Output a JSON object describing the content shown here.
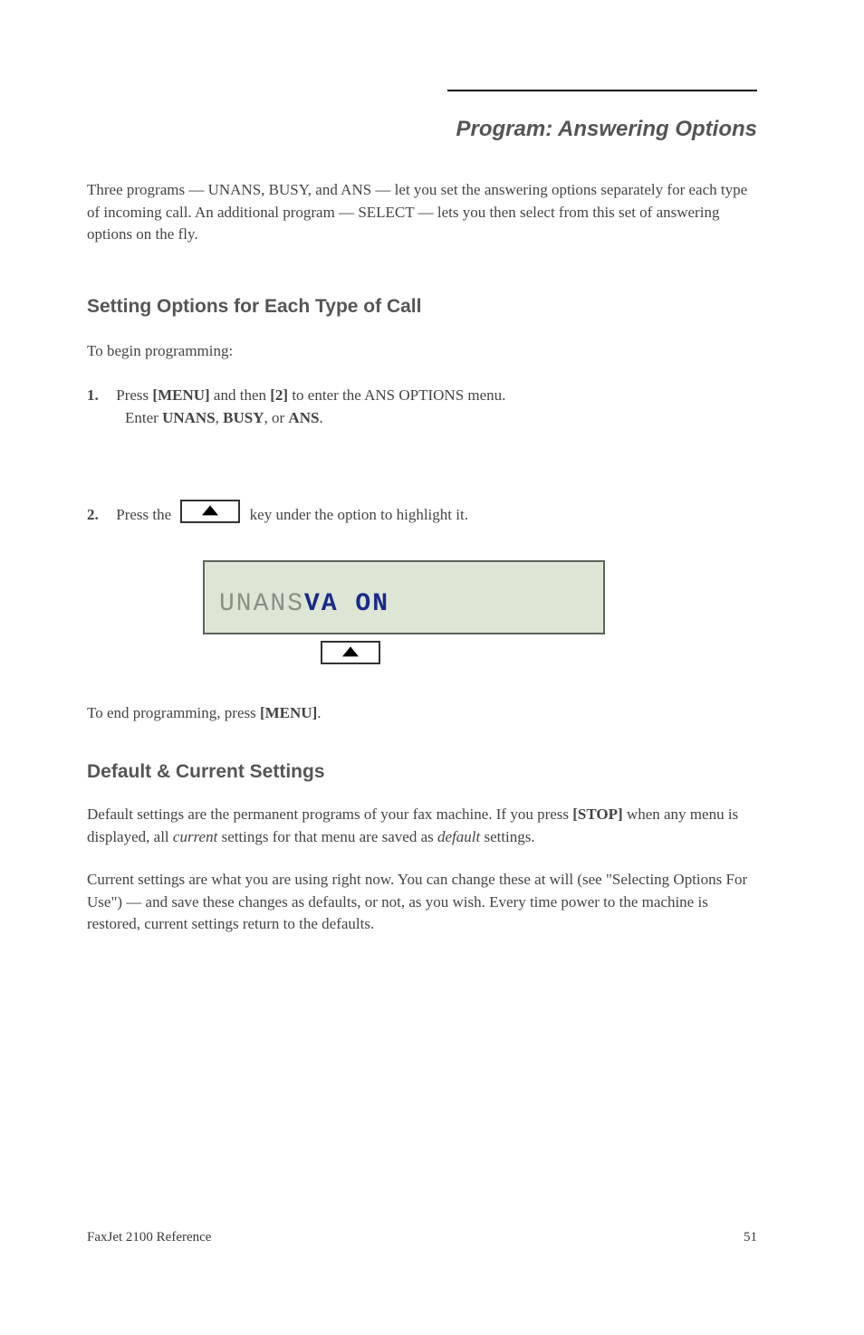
{
  "header_line": true,
  "section_title": "Program: Answering Options",
  "intro_para": "Three programs — UNANS, BUSY, and ANS — let you set the answering options separately for each type of incoming call. An additional program — SELECT — lets you then select from this set of answering options on the fly.",
  "subheading_1": "Setting Options for Each Type of Call",
  "to_begin": "To begin programming:",
  "step1": {
    "num": "1.",
    "line1_a": "Press ",
    "line1_b": "[MENU]",
    "line1_c": " and then ",
    "line1_d": "[2]",
    "line1_e": " to enter the ANS OPTIONS menu.",
    "line2_a": "Enter ",
    "line2_b": "UNANS",
    "line2_c": ", ",
    "line2_d": "BUSY",
    "line2_e": ", or ",
    "line2_f": "ANS",
    "line2_g": "."
  },
  "step2": {
    "num": "2.",
    "line": "Press the          key under the option to highlight it."
  },
  "lcd": {
    "dim": "UNANS ",
    "active": "VA ON"
  },
  "end_program": "To end programming, press ",
  "end_program_key": "[MENU]",
  "end_program_tail": ".",
  "subheading_2": "Default & Current Settings",
  "def_para_a": "Default settings are the permanent programs of your fax machine. If you press ",
  "def_para_b": "[STOP]",
  "def_para_c": " when any menu is displayed, all ",
  "def_para_d": "current",
  "def_para_e": " settings for that menu are saved as ",
  "def_para_f": "default",
  "def_para_g": " settings.",
  "def2_para": "Current settings are what you are using right now. You can change these at will (see \"Selecting Options For Use\") — and save these changes as defaults, or not, as you wish. Every time power to the machine is restored, current settings return to the defaults.",
  "footer_left": "FaxJet 2100 Reference",
  "footer_right": "51"
}
